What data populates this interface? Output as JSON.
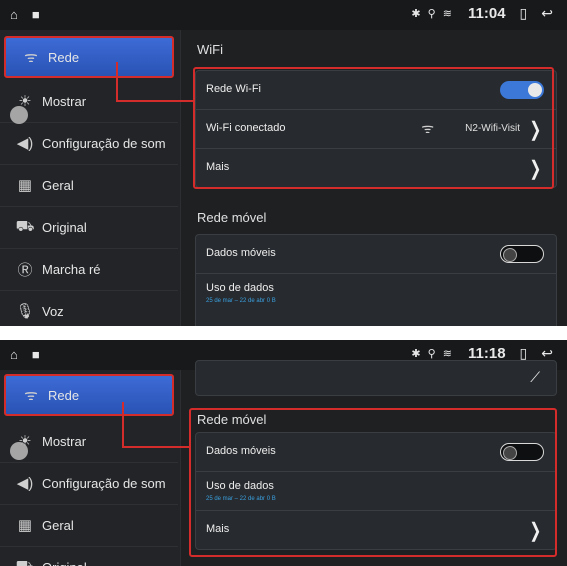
{
  "status": {
    "time_top": "11:04",
    "time_bottom": "11:18",
    "icons": "✱ ⚲ ≋"
  },
  "sidebar": {
    "items": [
      {
        "label": "Rede",
        "icon": "wifi-antenna-icon"
      },
      {
        "label": "Mostrar",
        "icon": "brightness-icon"
      },
      {
        "label": "Configuração de som",
        "icon": "speaker-icon"
      },
      {
        "label": "Geral",
        "icon": "grid-icon"
      },
      {
        "label": "Original",
        "icon": "car-icon"
      },
      {
        "label": "Marcha ré",
        "icon": "reverse-r-icon"
      },
      {
        "label": "Voz",
        "icon": "microphone-icon"
      }
    ]
  },
  "wifi": {
    "title": "WiFi",
    "rows": {
      "rede_wifi": "Rede Wi-Fi",
      "conectado": "Wi-Fi conectado",
      "network": "N2-Wifi-Visit",
      "mais": "Mais"
    }
  },
  "mobile": {
    "title": "Rede móvel",
    "dados": "Dados móveis",
    "uso": "Uso de dados",
    "uso_sub": "25 de mar – 22 de abr 0 B",
    "mais": "Mais"
  },
  "colors": {
    "accent": "#3b78d8",
    "highlight": "#d42b2b"
  }
}
